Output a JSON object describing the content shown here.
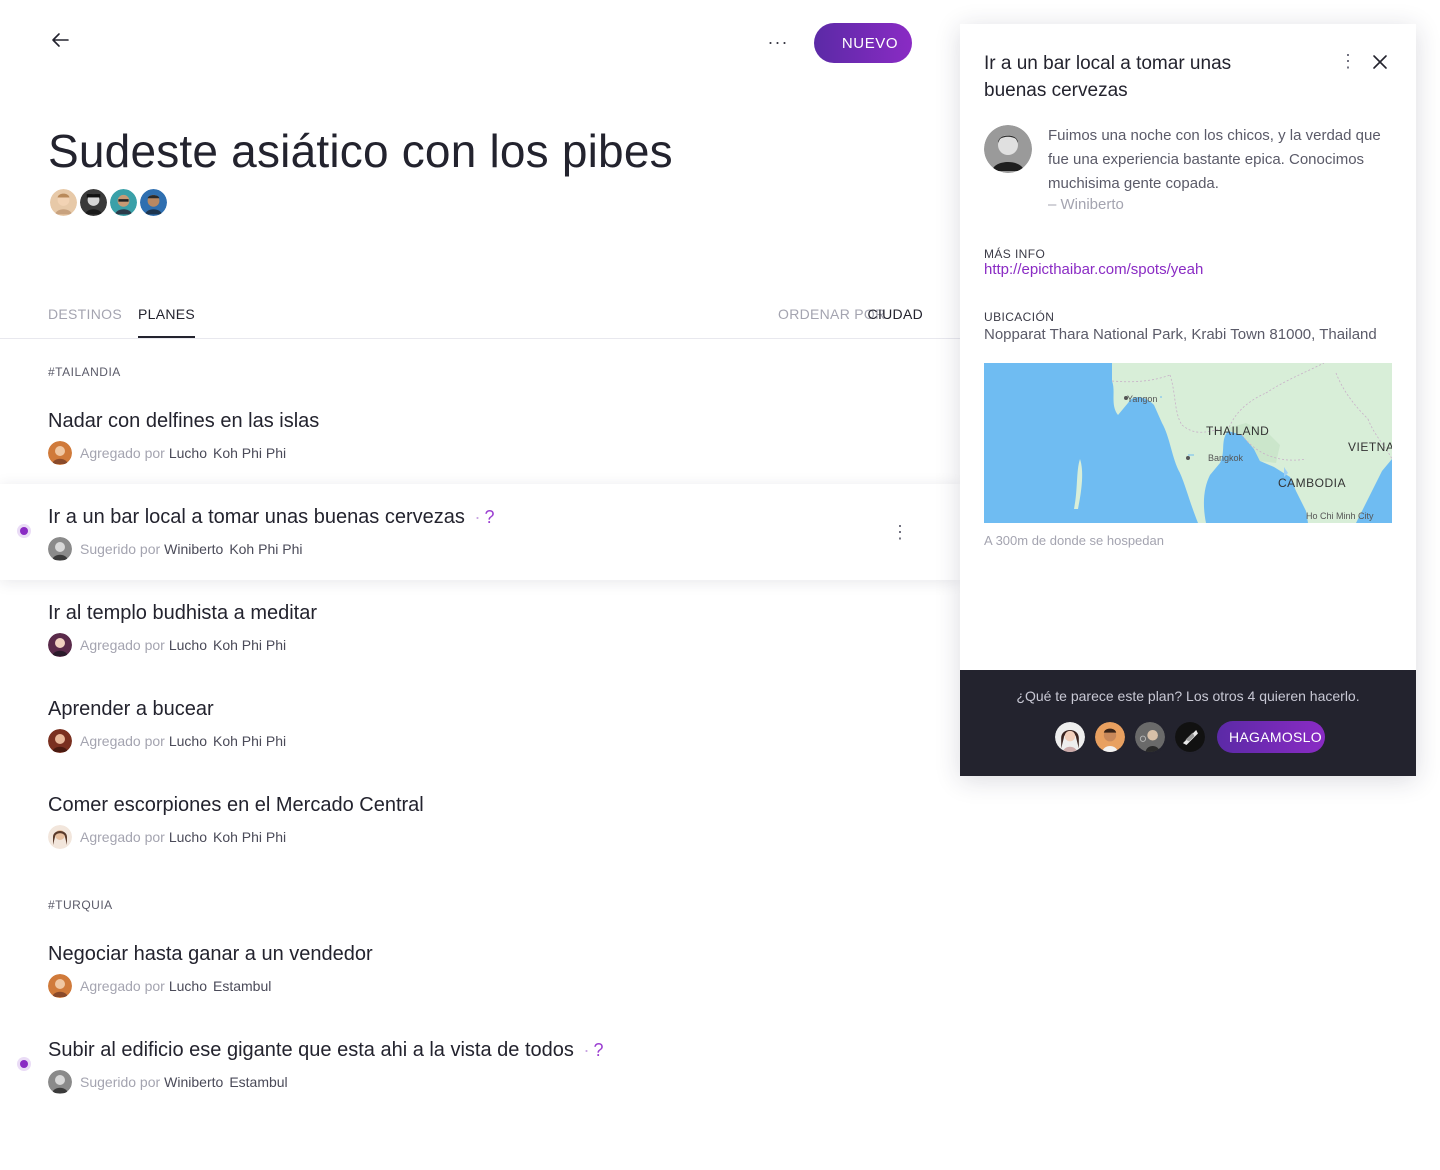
{
  "header": {
    "back_icon": "arrow-left-icon",
    "more_label": "···",
    "new_button": "NUEVO",
    "title": "Sudeste asiático con los pibes"
  },
  "tabs": [
    {
      "label": "DESTINOS",
      "active": false
    },
    {
      "label": "PLANES",
      "active": true
    }
  ],
  "sort": {
    "label": "ORDENAR POR",
    "value": "CIUDAD"
  },
  "sections": [
    {
      "tag": "#TAILANDIA"
    },
    {
      "tag": "#TURQUIA"
    }
  ],
  "plans": [
    {
      "title": "Nadar con delfines en las islas",
      "by_label": "Agregado por",
      "user": "Lucho",
      "place": "Koh Phi Phi"
    },
    {
      "title": "Ir a un bar local a tomar unas buenas cervezas",
      "question": "?",
      "separator": "·",
      "by_label": "Sugerido por",
      "user": "Winiberto",
      "place": "Koh Phi Phi",
      "kebab": "⋮"
    },
    {
      "title": "Ir al templo budhista a meditar",
      "by_label": "Agregado por",
      "user": "Lucho",
      "place": "Koh Phi Phi"
    },
    {
      "title": "Aprender a bucear",
      "by_label": "Agregado por",
      "user": "Lucho",
      "place": "Koh Phi Phi"
    },
    {
      "title": "Comer escorpiones en el Mercado Central",
      "by_label": "Agregado por",
      "user": "Lucho",
      "place": "Koh Phi Phi"
    },
    {
      "title": "Negociar hasta ganar a un vendedor",
      "by_label": "Agregado por",
      "user": "Lucho",
      "place": "Estambul"
    },
    {
      "title": "Subir al edificio ese gigante que esta ahi a la vista de todos",
      "question": "?",
      "separator": "·",
      "by_label": "Sugerido por",
      "user": "Winiberto",
      "place": "Estambul"
    }
  ],
  "panel": {
    "title": "Ir a un bar local a tomar unas buenas cervezas",
    "kebab": "⋮",
    "quote": "Fuimos una noche con los chicos, y la verdad que fue una experiencia bastante epica. Conocimos muchisima gente copada.",
    "quote_author": "– Winiberto",
    "more_info_label": "MÁS INFO",
    "more_info_link": "http://epicthaibar.com/spots/yeah",
    "location_label": "UBICACIÓN",
    "address": "Nopparat Thara National Park, Krabi Town 81000, Thailand",
    "map_labels": {
      "yangon": "Yangon",
      "thailand": "THAILAND",
      "bangkok": "Bangkok",
      "vietnam": "VIETNA",
      "cambodia": "CAMBODIA",
      "hochiminh": "Ho Chi Minh City"
    },
    "distance_note": "A 300m de donde se hospedan",
    "footer_text": "¿Qué te parece este plan? Los otros 4 quieren hacerlo.",
    "cta": "HAGAMOSLO"
  },
  "colors": {
    "accent": "#8a2bc4",
    "accent_dark": "#5b2aa6",
    "footer_bg": "#23232e",
    "map_water": "#6fbcf2",
    "map_land": "#d8eed8"
  }
}
